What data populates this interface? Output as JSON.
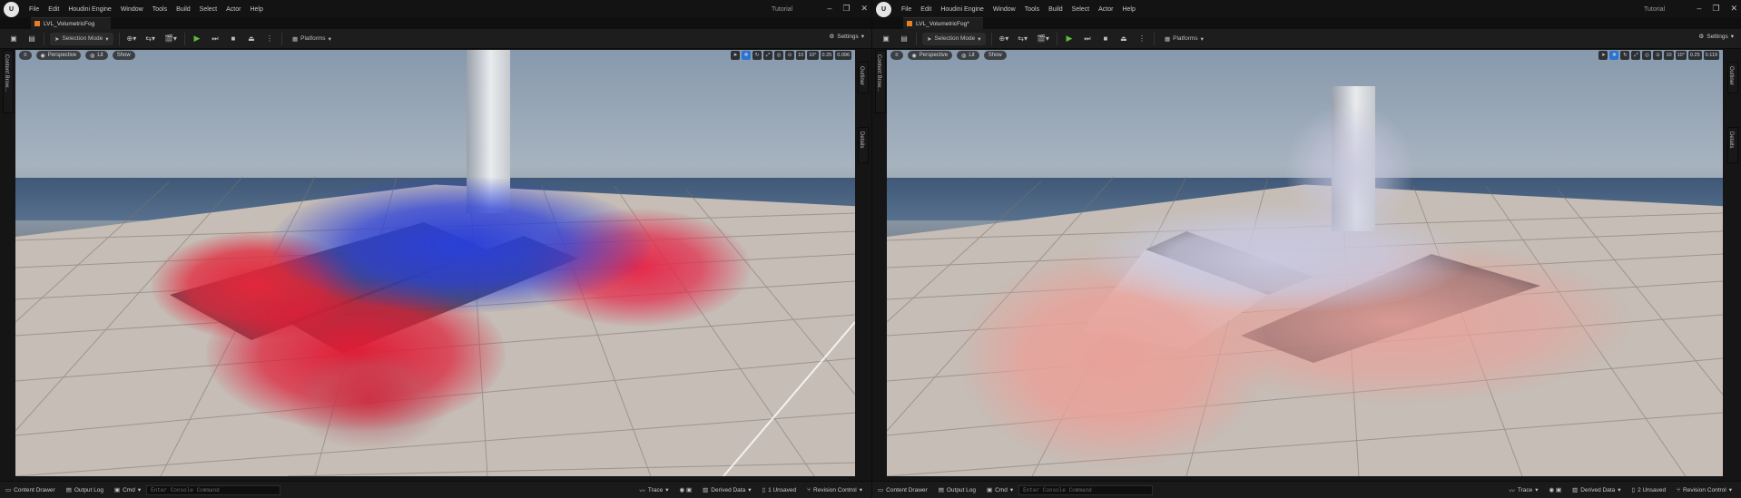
{
  "menu": [
    "File",
    "Edit",
    "Houdini Engine",
    "Window",
    "Tools",
    "Build",
    "Select",
    "Actor",
    "Help"
  ],
  "left": {
    "project": "Tutorial",
    "map_tab": "LVL_VolumetricFog",
    "selection_mode": "Selection Mode",
    "platforms": "Platforms",
    "settings": "Settings",
    "viewport": {
      "perspective": "Perspective",
      "lit": "Lit",
      "show": "Show",
      "grid": "10",
      "angle": "10°",
      "scale": "0.25",
      "camera_speed": "0.096"
    },
    "side_left": "Content Brow...",
    "side_outliner": "Outliner",
    "side_details": "Details",
    "status": {
      "content_drawer": "Content Drawer",
      "output_log": "Output Log",
      "cmd": "Cmd",
      "console_placeholder": "Enter Console Command",
      "trace": "Trace",
      "derived_data": "Derived Data",
      "unsaved": "1 Unsaved",
      "revision_control": "Revision Control"
    }
  },
  "right": {
    "project": "Tutorial",
    "map_tab": "LVL_VolumetricFog*",
    "selection_mode": "Selection Mode",
    "platforms": "Platforms",
    "settings": "Settings",
    "viewport": {
      "perspective": "Perspective",
      "lit": "Lit",
      "show": "Show",
      "grid": "10",
      "angle": "10°",
      "scale": "0.25",
      "camera_speed": "0.119"
    },
    "side_left": "Content Brow...",
    "side_outliner": "Outliner",
    "side_details": "Details",
    "status": {
      "content_drawer": "Content Drawer",
      "output_log": "Output Log",
      "cmd": "Cmd",
      "console_placeholder": "Enter Console Command",
      "trace": "Trace",
      "derived_data": "Derived Data",
      "unsaved": "2 Unsaved",
      "revision_control": "Revision Control"
    }
  },
  "colors": {
    "play": "#5dbb3a",
    "active_tool": "#2a73d1",
    "tab_icon": "#e67e22",
    "fog_red": "#e3263a",
    "fog_blue": "#2a3fd8",
    "fog_pink": "#e8a29a",
    "fog_lavender": "#c9c8de"
  }
}
